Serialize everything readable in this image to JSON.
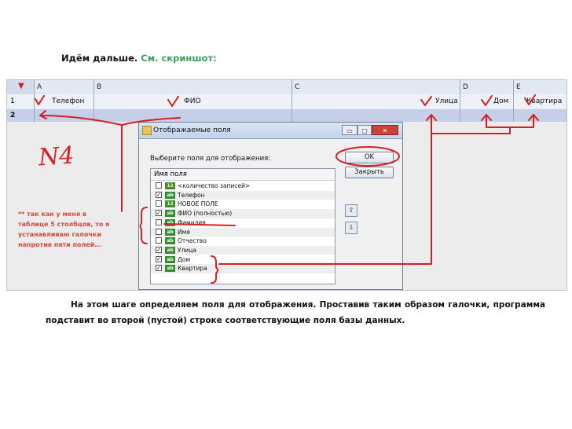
{
  "intro": {
    "text": "Идём дальше.",
    "link": "См. скриншот:"
  },
  "spreadsheet": {
    "columns": [
      "A",
      "B",
      "C",
      "D",
      "E"
    ],
    "row1": {
      "num": "1",
      "cells": [
        "Телефон",
        "ФИО",
        "Улица",
        "Дом",
        "Квартира"
      ]
    },
    "row2": {
      "num": "2"
    }
  },
  "dialog": {
    "title": "Отображаемые поля",
    "prompt": "Выберите поля для отображения:",
    "list_header": "Имя поля",
    "ok_label": "OK",
    "cancel_label": "Закрыть",
    "window_buttons": {
      "minimize": "▭",
      "maximize": "□",
      "close": "✕"
    },
    "items": [
      {
        "label": "<количество записей>",
        "tag": "12",
        "checked": false
      },
      {
        "label": "Телефон",
        "tag": "ab",
        "checked": true
      },
      {
        "label": "НОВОЕ ПОЛЕ",
        "tag": "12",
        "checked": false
      },
      {
        "label": "ФИО (полностью)",
        "tag": "ab",
        "checked": true
      },
      {
        "label": "Фамилия",
        "tag": "ab",
        "checked": false
      },
      {
        "label": "Имя",
        "tag": "ab",
        "checked": false
      },
      {
        "label": "Отчество",
        "tag": "ab",
        "checked": false
      },
      {
        "label": "Улица",
        "tag": "ab",
        "checked": true
      },
      {
        "label": "Дом",
        "tag": "ab",
        "checked": true
      },
      {
        "label": "Квартира",
        "tag": "ab",
        "checked": true
      }
    ],
    "move_up": "⇧",
    "move_down": "⇩"
  },
  "annotations": {
    "n4": "N4",
    "sidenote": "** так как у меня в таблице 5 столбцов, то я устанавливаю галочки напротив пяти полей…",
    "color": "#d42020"
  },
  "bottom_text": "На этом шаге определяем поля для отображения. Проставив таким образом галочки, программа подставит во второй (пустой) строке соответствующие поля базы данных."
}
